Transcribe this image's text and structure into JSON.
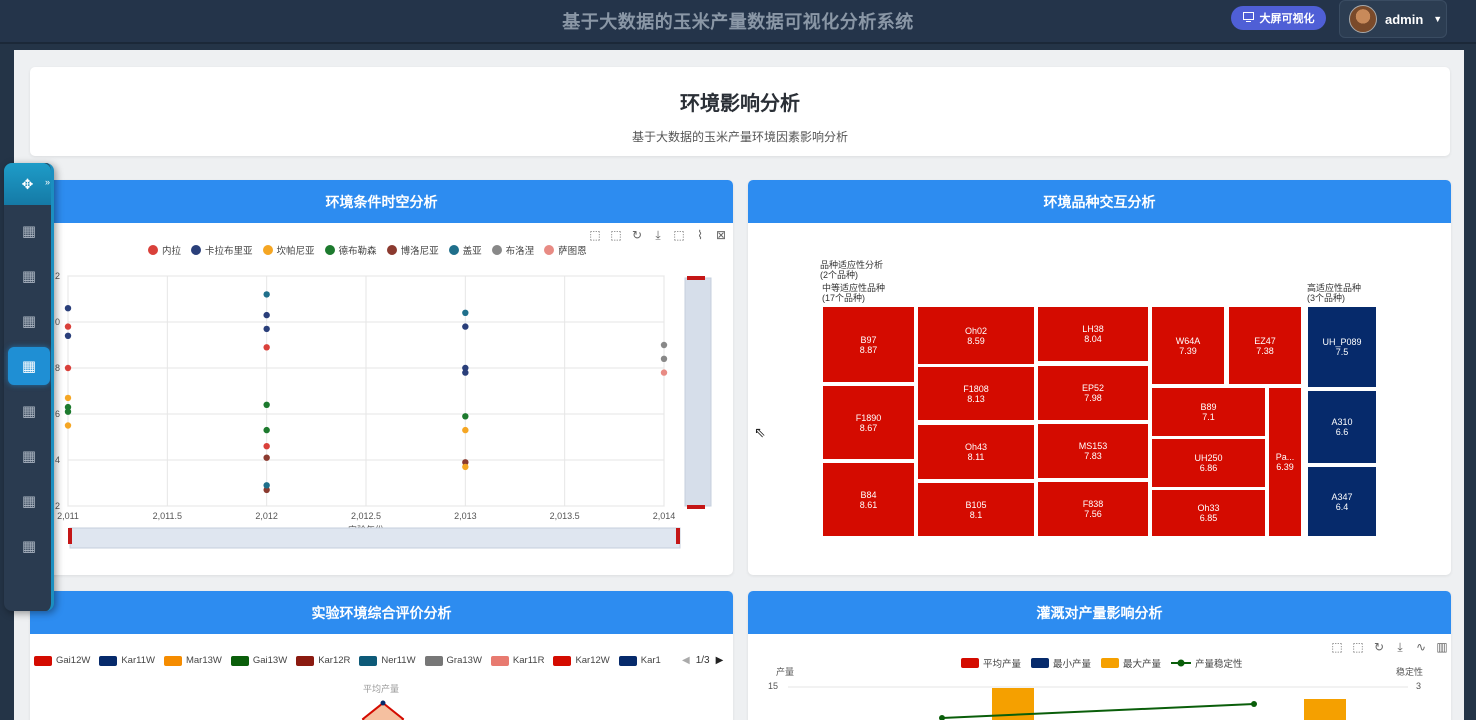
{
  "app": {
    "title": "基于大数据的玉米产量数据可视化分析系统",
    "bigscreen_label": "大屏可视化",
    "user_name": "admin"
  },
  "page": {
    "title": "环境影响分析",
    "subtitle": "基于大数据的玉米产量环境因素影响分析"
  },
  "panels": {
    "spatiotemporal": "环境条件时空分析",
    "variety_interaction": "环境品种交互分析",
    "comprehensive": "实验环境综合评价分析",
    "irrigation": "灌溉对产量影响分析"
  },
  "colors": {
    "accent": "#2d8cf0",
    "treemap_red": "#d40b00",
    "treemap_blue": "#062a6b"
  },
  "chart_data": [
    {
      "type": "scatter",
      "xlabel": "实验年份",
      "xlim": [
        2011,
        2014
      ],
      "x_ticks": [
        "2,011",
        "2,011.5",
        "2,012",
        "2,012.5",
        "2,013",
        "2,013.5",
        "2,014"
      ],
      "y_ticks": [
        "2",
        "0",
        "8",
        "6",
        "4",
        "2"
      ],
      "legend": [
        {
          "name": "内拉",
          "color": "#d9403a"
        },
        {
          "name": "卡拉布里亚",
          "color": "#2a3f7a"
        },
        {
          "name": "坎帕尼亚",
          "color": "#f5a623"
        },
        {
          "name": "德布勒森",
          "color": "#1d7a2e"
        },
        {
          "name": "博洛尼亚",
          "color": "#8b3a2f"
        },
        {
          "name": "盖亚",
          "color": "#1f6f8b"
        },
        {
          "name": "布洛涅",
          "color": "#888888"
        },
        {
          "name": "萨图恩",
          "color": "#e88b84"
        }
      ],
      "points": [
        {
          "x": 2011,
          "y": 9.8,
          "s": 0
        },
        {
          "x": 2011,
          "y": 8.0,
          "s": 0
        },
        {
          "x": 2011,
          "y": 10.6,
          "s": 1
        },
        {
          "x": 2011,
          "y": 9.4,
          "s": 1
        },
        {
          "x": 2011,
          "y": 6.7,
          "s": 2
        },
        {
          "x": 2011,
          "y": 5.5,
          "s": 2
        },
        {
          "x": 2011,
          "y": 6.3,
          "s": 3
        },
        {
          "x": 2011,
          "y": 6.1,
          "s": 3
        },
        {
          "x": 2012,
          "y": 8.9,
          "s": 0
        },
        {
          "x": 2012,
          "y": 4.6,
          "s": 0
        },
        {
          "x": 2012,
          "y": 10.3,
          "s": 1
        },
        {
          "x": 2012,
          "y": 9.7,
          "s": 1
        },
        {
          "x": 2012,
          "y": 6.4,
          "s": 3
        },
        {
          "x": 2012,
          "y": 5.3,
          "s": 3
        },
        {
          "x": 2012,
          "y": 4.1,
          "s": 4
        },
        {
          "x": 2012,
          "y": 2.7,
          "s": 4
        },
        {
          "x": 2012,
          "y": 11.2,
          "s": 5
        },
        {
          "x": 2012,
          "y": 2.9,
          "s": 5
        },
        {
          "x": 2013,
          "y": 10.4,
          "s": 5
        },
        {
          "x": 2013,
          "y": 9.8,
          "s": 1
        },
        {
          "x": 2013,
          "y": 8.0,
          "s": 1
        },
        {
          "x": 2013,
          "y": 7.8,
          "s": 1
        },
        {
          "x": 2013,
          "y": 5.9,
          "s": 3
        },
        {
          "x": 2013,
          "y": 5.3,
          "s": 2
        },
        {
          "x": 2013,
          "y": 3.9,
          "s": 4
        },
        {
          "x": 2013,
          "y": 3.7,
          "s": 2
        },
        {
          "x": 2014,
          "y": 9.0,
          "s": 6
        },
        {
          "x": 2014,
          "y": 8.4,
          "s": 6
        },
        {
          "x": 2014,
          "y": 7.8,
          "s": 7
        }
      ]
    },
    {
      "type": "treemap",
      "groups": [
        {
          "title": "品种适应性分析",
          "count": "(2个品种)"
        },
        {
          "title": "中等适应性品种",
          "count": "(17个品种)"
        },
        {
          "title": "高适应性品种",
          "count": "(3个品种)"
        }
      ],
      "cells": [
        {
          "name": "B97",
          "value": "8.87"
        },
        {
          "name": "F1890",
          "value": "8.67"
        },
        {
          "name": "B84",
          "value": "8.61"
        },
        {
          "name": "Oh02",
          "value": "8.59"
        },
        {
          "name": "F1808",
          "value": "8.13"
        },
        {
          "name": "Oh43",
          "value": "8.11"
        },
        {
          "name": "B105",
          "value": "8.1"
        },
        {
          "name": "LH38",
          "value": "8.04"
        },
        {
          "name": "EP52",
          "value": "7.98"
        },
        {
          "name": "MS153",
          "value": "7.83"
        },
        {
          "name": "F838",
          "value": "7.56"
        },
        {
          "name": "W64A",
          "value": "7.39"
        },
        {
          "name": "EZ47",
          "value": "7.38"
        },
        {
          "name": "B89",
          "value": "7.1"
        },
        {
          "name": "UH250",
          "value": "6.86"
        },
        {
          "name": "Oh33",
          "value": "6.85"
        },
        {
          "name": "Pa...",
          "value": "6.39"
        },
        {
          "name": "UH_P089",
          "value": "7.5"
        },
        {
          "name": "A310",
          "value": "6.6"
        },
        {
          "name": "A347",
          "value": "6.4"
        }
      ]
    },
    {
      "type": "radar",
      "indicator_visible": "平均产量",
      "legend": [
        {
          "name": "Gai12W",
          "color": "#d40b00"
        },
        {
          "name": "Kar11W",
          "color": "#062a6b"
        },
        {
          "name": "Mar13W",
          "color": "#f58c00"
        },
        {
          "name": "Gai13W",
          "color": "#0a5e0a"
        },
        {
          "name": "Kar12R",
          "color": "#8b1a10"
        },
        {
          "name": "Ner11W",
          "color": "#0d5a78"
        },
        {
          "name": "Gra13W",
          "color": "#777777"
        },
        {
          "name": "Kar11R",
          "color": "#e87a70"
        },
        {
          "name": "Kar12W",
          "color": "#d40b00"
        },
        {
          "name": "Kar1",
          "color": "#062a6b"
        }
      ],
      "pager": "1/3"
    },
    {
      "type": "bar",
      "ylabel": "产量",
      "y2label": "稳定性",
      "y_max_label": "15",
      "y2_max_label": "3",
      "legend": [
        {
          "name": "平均产量",
          "color": "#d40b00"
        },
        {
          "name": "最小产量",
          "color": "#062a6b"
        },
        {
          "name": "最大产量",
          "color": "#f5a000"
        },
        {
          "name": "产量稳定性",
          "color": "#0a5e0a"
        }
      ]
    }
  ]
}
